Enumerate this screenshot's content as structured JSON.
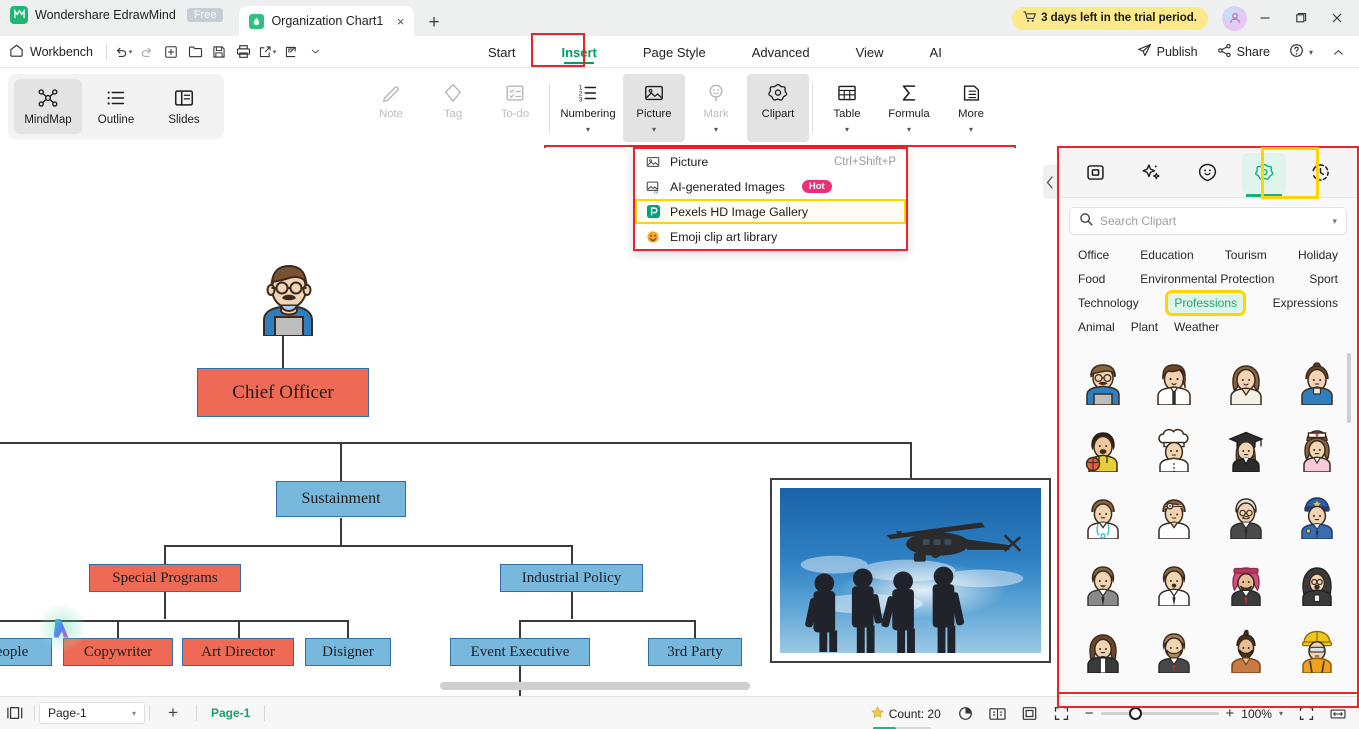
{
  "titlebar": {
    "brand": "Wondershare EdrawMind",
    "free_badge": "Free",
    "tab_title": "Organization Chart1",
    "tab_close": "×",
    "new_tab": "+",
    "trial_text": "3 days left in the trial period.",
    "minimize": "—",
    "maximize": "❐",
    "close": "✕"
  },
  "menubar": {
    "workbench": "Workbench",
    "quick_icons": [
      "undo-icon",
      "redo-icon",
      "new-icon",
      "open-icon",
      "save-icon",
      "print-icon",
      "export-icon",
      "import-icon",
      "more-icon"
    ],
    "tabs": [
      {
        "label": "Start",
        "active": false
      },
      {
        "label": "Insert",
        "active": true
      },
      {
        "label": "Page Style",
        "active": false
      },
      {
        "label": "Advanced",
        "active": false
      },
      {
        "label": "View",
        "active": false
      },
      {
        "label": "AI",
        "active": false
      }
    ],
    "publish": "Publish",
    "share": "Share",
    "help": "?"
  },
  "ribbon": {
    "view_modes": [
      {
        "label": "MindMap",
        "selected": true
      },
      {
        "label": "Outline",
        "selected": false
      },
      {
        "label": "Slides",
        "selected": false
      }
    ],
    "tools": [
      {
        "label": "Note",
        "disabled": true,
        "caret": false,
        "highlighted": false
      },
      {
        "label": "Tag",
        "disabled": true,
        "caret": false,
        "highlighted": false
      },
      {
        "label": "To-do",
        "disabled": true,
        "caret": false,
        "highlighted": false
      },
      {
        "label": "Numbering",
        "disabled": false,
        "caret": true,
        "highlighted": false
      },
      {
        "label": "Picture",
        "disabled": false,
        "caret": true,
        "highlighted": true
      },
      {
        "label": "Mark",
        "disabled": true,
        "caret": true,
        "highlighted": false
      },
      {
        "label": "Clipart",
        "disabled": false,
        "caret": false,
        "highlighted": true
      },
      {
        "label": "Table",
        "disabled": false,
        "caret": true,
        "highlighted": false
      },
      {
        "label": "Formula",
        "disabled": false,
        "caret": true,
        "highlighted": false
      },
      {
        "label": "More",
        "disabled": false,
        "caret": true,
        "highlighted": false
      }
    ]
  },
  "picture_menu": {
    "items": [
      {
        "label": "Picture",
        "shortcut": "Ctrl+Shift+P",
        "badge": "",
        "boxed": false
      },
      {
        "label": "AI-generated Images",
        "shortcut": "",
        "badge": "Hot",
        "boxed": false
      },
      {
        "label": "Pexels HD Image Gallery",
        "shortcut": "",
        "badge": "",
        "boxed": true
      },
      {
        "label": "Emoji clip art library",
        "shortcut": "",
        "badge": "",
        "boxed": false
      }
    ]
  },
  "right_panel": {
    "tabs": [
      {
        "name": "shape-icon",
        "active": false
      },
      {
        "name": "sparkle-icon",
        "active": false
      },
      {
        "name": "sticker-icon",
        "active": false
      },
      {
        "name": "clipart-icon",
        "active": true
      },
      {
        "name": "recent-icon",
        "active": false
      }
    ],
    "search_placeholder": "Search Clipart",
    "search_value": "",
    "categories": [
      {
        "label": "Office",
        "selected": false
      },
      {
        "label": "Education",
        "selected": false
      },
      {
        "label": "Tourism",
        "selected": false
      },
      {
        "label": "Holiday",
        "selected": false
      },
      {
        "label": "Food",
        "selected": false
      },
      {
        "label": "Environmental Protection",
        "selected": false
      },
      {
        "label": "Sport",
        "selected": false
      },
      {
        "label": "Technology",
        "selected": false
      },
      {
        "label": "Professions",
        "selected": true
      },
      {
        "label": "Expressions",
        "selected": false
      },
      {
        "label": "Animal",
        "selected": false
      },
      {
        "label": "Plant",
        "selected": false
      },
      {
        "label": "Weather",
        "selected": false
      }
    ],
    "clipart_items": [
      "man-glasses-laptop",
      "woman-office-suit",
      "woman-long-hair",
      "boy-blue-shirt",
      "man-basketball",
      "chef-hat",
      "graduate-cap",
      "nurse-cap",
      "doctor-coat",
      "doctor-headmirror",
      "old-man-suit",
      "police-officer",
      "man-grey-suit",
      "man-white-shirt",
      "man-keffiyeh",
      "woman-hijab",
      "woman-dark-suit",
      "man-beard-suit",
      "man-top-knot",
      "worker-hardhat"
    ]
  },
  "canvas": {
    "nodes": [
      {
        "label": "Chief Officer",
        "color": "red"
      },
      {
        "label": "Sustainment",
        "color": "blue"
      },
      {
        "label": "Special Programs",
        "color": "red"
      },
      {
        "label": "Industrial Policy",
        "color": "blue"
      },
      {
        "label": "eople",
        "color": "blue"
      },
      {
        "label": "Copywriter",
        "color": "red"
      },
      {
        "label": "Art Director",
        "color": "red"
      },
      {
        "label": "Disigner",
        "color": "blue"
      },
      {
        "label": "Event Executive",
        "color": "blue"
      },
      {
        "label": "3rd Party",
        "color": "blue"
      }
    ],
    "image_alt": "soldiers-helicopter-photo"
  },
  "statusbar": {
    "page_select": "Page-1",
    "add_page": "+",
    "page_tab": "Page-1",
    "count_label": "Count: 20",
    "zoom_value": "100%",
    "zoom_out": "−",
    "zoom_in": "+"
  },
  "colors": {
    "accent_green": "#19b27c",
    "red_annotation": "#e8252a",
    "yellow_annotation": "#ffd400",
    "node_red": "#ef6a55",
    "node_blue": "#78b8dd",
    "trial_yellow": "#fbe98a"
  }
}
